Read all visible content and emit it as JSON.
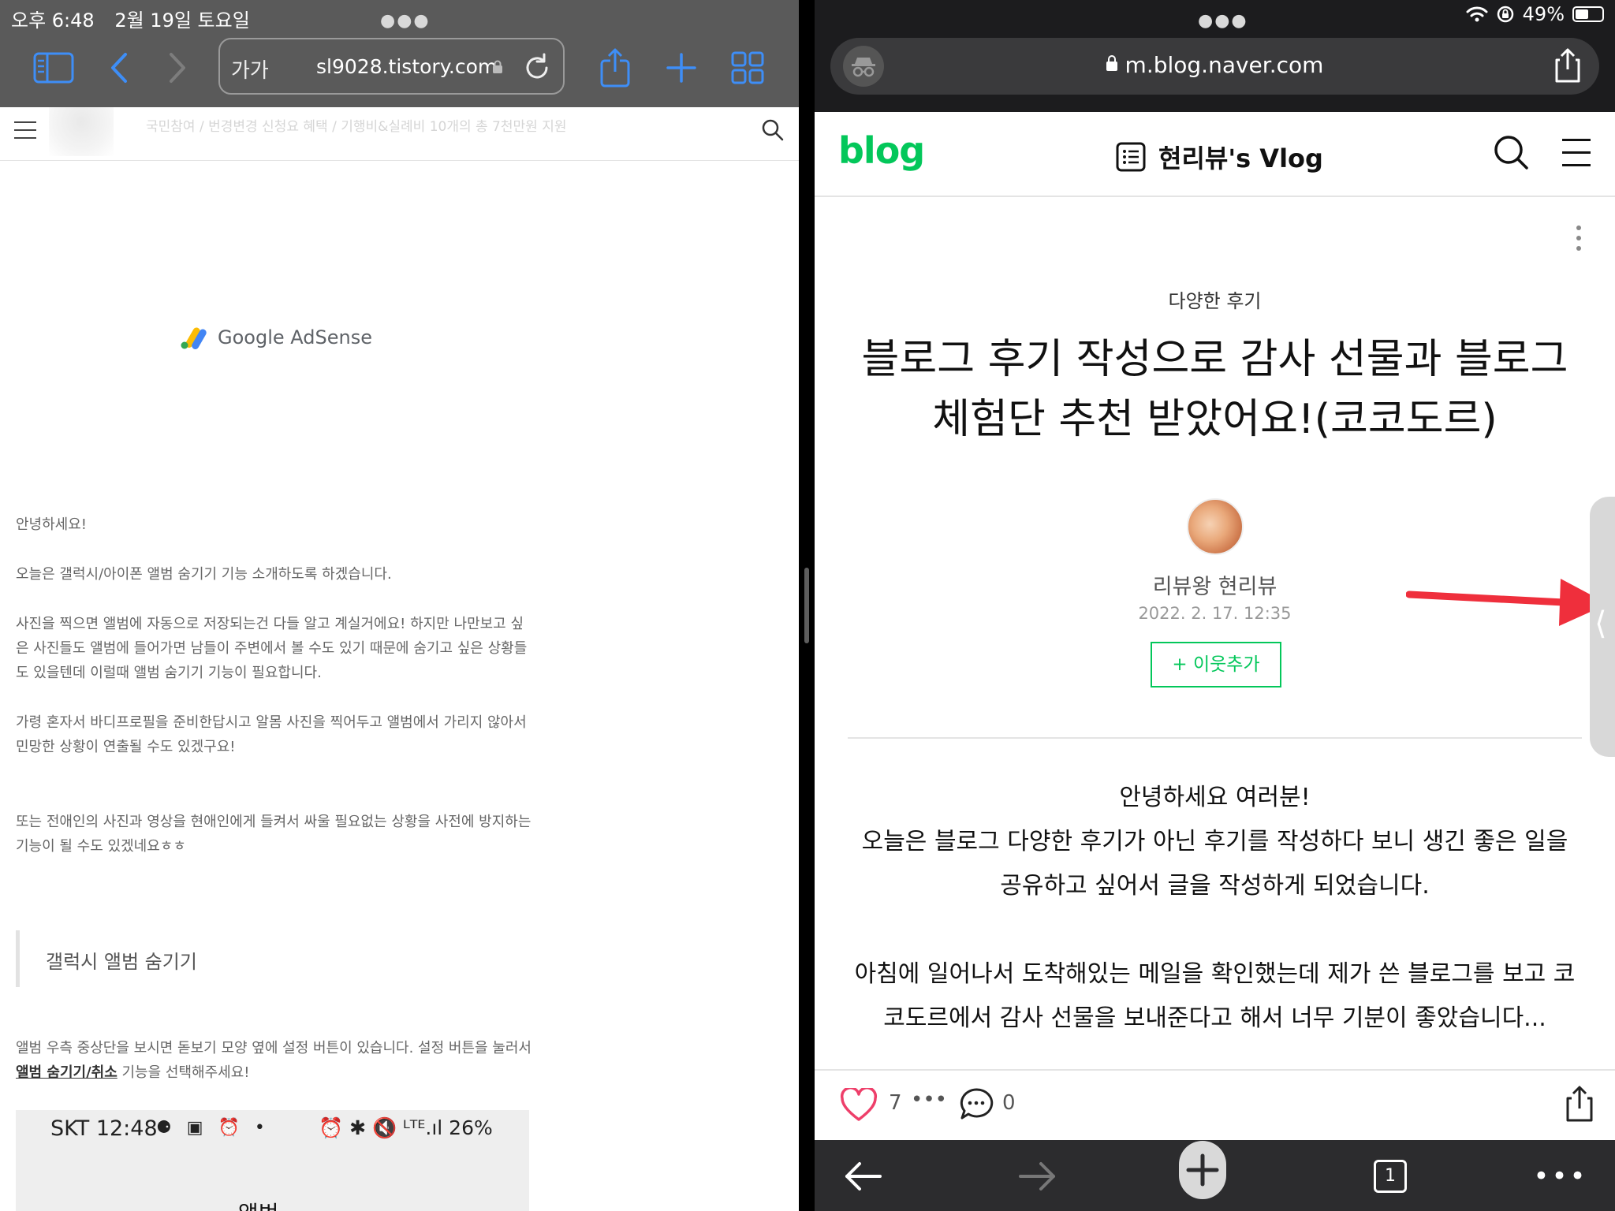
{
  "left": {
    "status": {
      "time": "오후 6:48",
      "date": "2월 19일 토요일"
    },
    "toolbar": {
      "text_size_label": "가가",
      "url": "sl9028.tistory.com"
    },
    "site_header": {
      "faded_text": "국민참여 / 번경변경 신청요 혜택 / 기행비&실례비 10개의 총 7천만원 지원"
    },
    "ad": {
      "brand": "Google AdSense"
    },
    "paragraphs": [
      "안녕하세요!",
      "오늘은 갤럭시/아이폰 앨범 숨기기 기능 소개하도록 하겠습니다.",
      "사진을 찍으면 앨범에 자동으로 저장되는건 다들 알고 계실거에요! 하지만 나만보고 싶은 사진들도 앨범에 들어가면 남들이 주변에서 볼 수도 있기 때문에 숨기고 싶은 상황들도 있을텐데 이럴때 앨범 숨기기 기능이 필요합니다.",
      "가령 혼자서 바디프로필을 준비한답시고 알몸 사진을 찍어두고 앨범에서 가리지 않아서 민망한 상황이 연출될 수도 있겠구요!",
      "또는 전애인의 사진과 영상을 현애인에게 들켜서 싸울 필요없는 상황을 사전에 방지하는 기능이 될 수도 있겠네요ㅎㅎ"
    ],
    "section_heading": "갤럭시 앨범 숨기기",
    "instruction": {
      "before": "앨범 우측 중상단을 보시면 돋보기 모양 옆에 설정 버튼이 있습니다. 설정 버튼을 눌러서 ",
      "link": "앨범 숨기기/취소",
      "after": " 기능을 선택해주세요!"
    },
    "phone_shot": {
      "time": "SKT 12:48",
      "icons": "⚈ ▣ ⏰ •",
      "right_status": "⏰ ✱ 🔇 ᴸᵀᴱ.ıl 26%",
      "label": "앨범"
    }
  },
  "right": {
    "status": {
      "battery": "49%"
    },
    "url": "m.blog.naver.com",
    "header": {
      "logo": "blog",
      "blog_name": "현리뷰's Vlog"
    },
    "category": "다양한 후기",
    "title": "블로그 후기 작성으로 감사 선물과 블로그 체험단 추천 받았어요!(코코도르)",
    "author": "리뷰왕 현리뷰",
    "date": "2022. 2. 17. 12:35",
    "neighbor_button": "+ 이웃추가",
    "body_para1": [
      "안녕하세요 여러분!",
      "오늘은 블로그 다양한 후기가 아닌 후기를 작성하다 보니 생긴 좋은 일을",
      "공유하고 싶어서 글을 작성하게 되었습니다."
    ],
    "body_para2": [
      "아침에 일어나서 도착해있는 메일을 확인했는데 제가 쓴 블로그를 보고 코",
      "코도르에서 감사 선물을 보내준다고 해서 너무 기분이 좋았습니다..."
    ],
    "actions": {
      "likes": "7",
      "comments": "0"
    },
    "bottom_bar": {
      "tab_count": "1"
    }
  },
  "colors": {
    "naver_green": "#03c75a",
    "safari_accent": "#3e8ef7",
    "arrow_red": "#ef2f3c",
    "heart_pink": "#ee3f6a"
  }
}
